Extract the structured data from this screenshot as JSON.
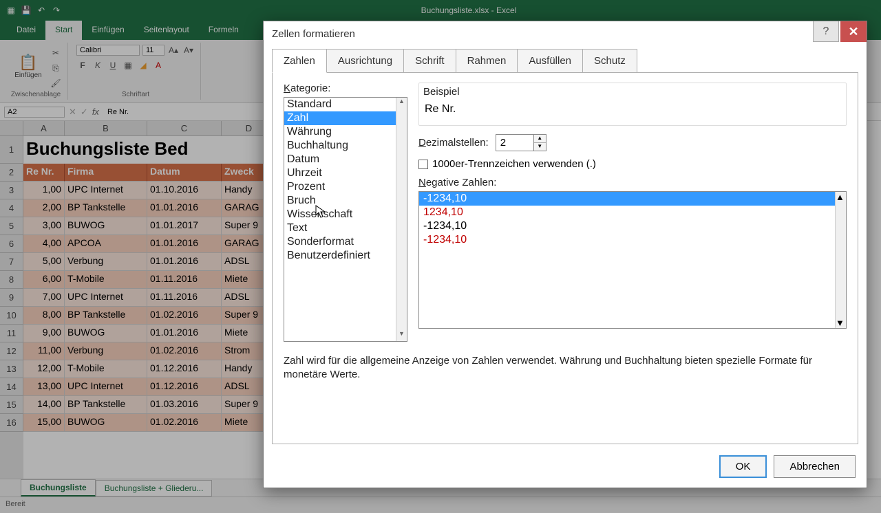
{
  "app": {
    "title": "Buchungsliste.xlsx - Excel"
  },
  "ribbon": {
    "tabs": [
      "Datei",
      "Start",
      "Einfügen",
      "Seitenlayout",
      "Formeln"
    ],
    "active": "Start",
    "clipboard": {
      "paste": "Einfügen",
      "label": "Zwischenablage"
    },
    "font": {
      "name": "Calibri",
      "size": "11",
      "label": "Schriftart"
    }
  },
  "formula_bar": {
    "cell_ref": "A2",
    "content": "Re Nr."
  },
  "sheet": {
    "columns": [
      "A",
      "B",
      "C",
      "D"
    ],
    "title_row": "Buchungsliste Bed",
    "headers": [
      "Re Nr.",
      "Firma",
      "Datum",
      "Zweck"
    ],
    "rows": [
      [
        "1,00",
        "UPC Internet",
        "01.10.2016",
        "Handy"
      ],
      [
        "2,00",
        "BP Tankstelle",
        "01.01.2016",
        "GARAG"
      ],
      [
        "3,00",
        "BUWOG",
        "01.01.2017",
        "Super 9"
      ],
      [
        "4,00",
        "APCOA",
        "01.01.2016",
        "GARAG"
      ],
      [
        "5,00",
        "Verbung",
        "01.01.2016",
        "ADSL"
      ],
      [
        "6,00",
        "T-Mobile",
        "01.11.2016",
        "Miete"
      ],
      [
        "7,00",
        "UPC Internet",
        "01.11.2016",
        "ADSL"
      ],
      [
        "8,00",
        "BP Tankstelle",
        "01.02.2016",
        "Super 9"
      ],
      [
        "9,00",
        "BUWOG",
        "01.01.2016",
        "Miete"
      ],
      [
        "11,00",
        "Verbung",
        "01.02.2016",
        "Strom"
      ],
      [
        "12,00",
        "T-Mobile",
        "01.12.2016",
        "Handy"
      ],
      [
        "13,00",
        "UPC Internet",
        "01.12.2016",
        "ADSL"
      ],
      [
        "14,00",
        "BP Tankstelle",
        "01.03.2016",
        "Super 9"
      ],
      [
        "15,00",
        "BUWOG",
        "01.02.2016",
        "Miete"
      ]
    ],
    "row_numbers": [
      "1",
      "2",
      "3",
      "4",
      "5",
      "6",
      "7",
      "8",
      "9",
      "10",
      "11",
      "12",
      "13",
      "14",
      "15",
      "16"
    ],
    "tabs": [
      "Buchungsliste",
      "Buchungsliste + Gliederu..."
    ],
    "active_tab": "Buchungsliste"
  },
  "status": {
    "text": "Bereit"
  },
  "dialog": {
    "title": "Zellen formatieren",
    "tabs": [
      "Zahlen",
      "Ausrichtung",
      "Schrift",
      "Rahmen",
      "Ausfüllen",
      "Schutz"
    ],
    "active_tab": "Zahlen",
    "category_label": "Kategorie:",
    "categories": [
      "Standard",
      "Zahl",
      "Währung",
      "Buchhaltung",
      "Datum",
      "Uhrzeit",
      "Prozent",
      "Bruch",
      "Wissenschaft",
      "Text",
      "Sonderformat",
      "Benutzerdefiniert"
    ],
    "selected_category": "Zahl",
    "sample_label": "Beispiel",
    "sample_value": "Re Nr.",
    "decimal_label": "Dezimalstellen:",
    "decimal_value": "2",
    "thousands_label": "1000er-Trennzeichen verwenden (.)",
    "thousands_checked": false,
    "negative_label": "Negative Zahlen:",
    "negative_options": [
      {
        "text": "-1234,10",
        "red": false,
        "selected": true
      },
      {
        "text": "1234,10",
        "red": true,
        "selected": false
      },
      {
        "text": "-1234,10",
        "red": false,
        "selected": false
      },
      {
        "text": "-1234,10",
        "red": true,
        "selected": false
      }
    ],
    "description": "Zahl wird für die allgemeine Anzeige von Zahlen verwendet. Währung und Buchhaltung bieten spezielle Formate für monetäre Werte.",
    "ok": "OK",
    "cancel": "Abbrechen"
  }
}
